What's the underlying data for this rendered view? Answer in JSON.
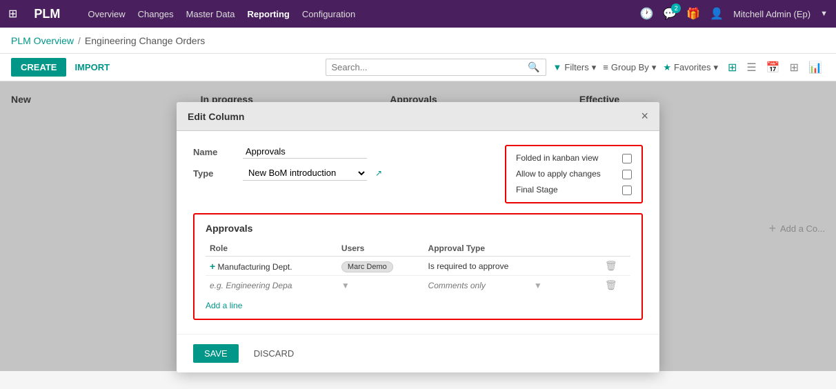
{
  "app": {
    "name": "PLM",
    "grid_icon": "⊞"
  },
  "nav": {
    "links": [
      "Overview",
      "Changes",
      "Master Data",
      "Reporting",
      "Configuration"
    ],
    "active": "Reporting",
    "user": "Mitchell Admin (Ep)",
    "notification_count": "2"
  },
  "breadcrumb": {
    "parent": "PLM Overview",
    "separator": "/",
    "current": "Engineering Change Orders"
  },
  "toolbar": {
    "create_label": "CREATE",
    "import_label": "IMPORT",
    "search_placeholder": "Search...",
    "filters_label": "Filters",
    "groupby_label": "Group By",
    "favorites_label": "Favorites"
  },
  "kanban": {
    "columns": [
      "New",
      "In progress",
      "Approvals",
      "Effective"
    ],
    "add_col_label": "Add a Co..."
  },
  "modal": {
    "title": "Edit Column",
    "close_label": "×",
    "form": {
      "name_label": "Name",
      "name_value": "Approvals",
      "type_label": "Type",
      "type_value": "New BoM introduction"
    },
    "checkboxes": {
      "folded_label": "Folded in kanban view",
      "allow_label": "Allow to apply changes",
      "final_label": "Final Stage"
    },
    "approvals": {
      "section_title": "Approvals",
      "col_role": "Role",
      "col_users": "Users",
      "col_approval_type": "Approval Type",
      "rows": [
        {
          "role": "Manufacturing Dept.",
          "user": "Marc Demo",
          "approval_type": "Is required to approve"
        }
      ],
      "placeholder_role": "e.g. Engineering Department",
      "placeholder_approval": "Comments only",
      "add_line": "Add a line"
    },
    "footer": {
      "save_label": "SAVE",
      "discard_label": "DISCARD"
    }
  }
}
